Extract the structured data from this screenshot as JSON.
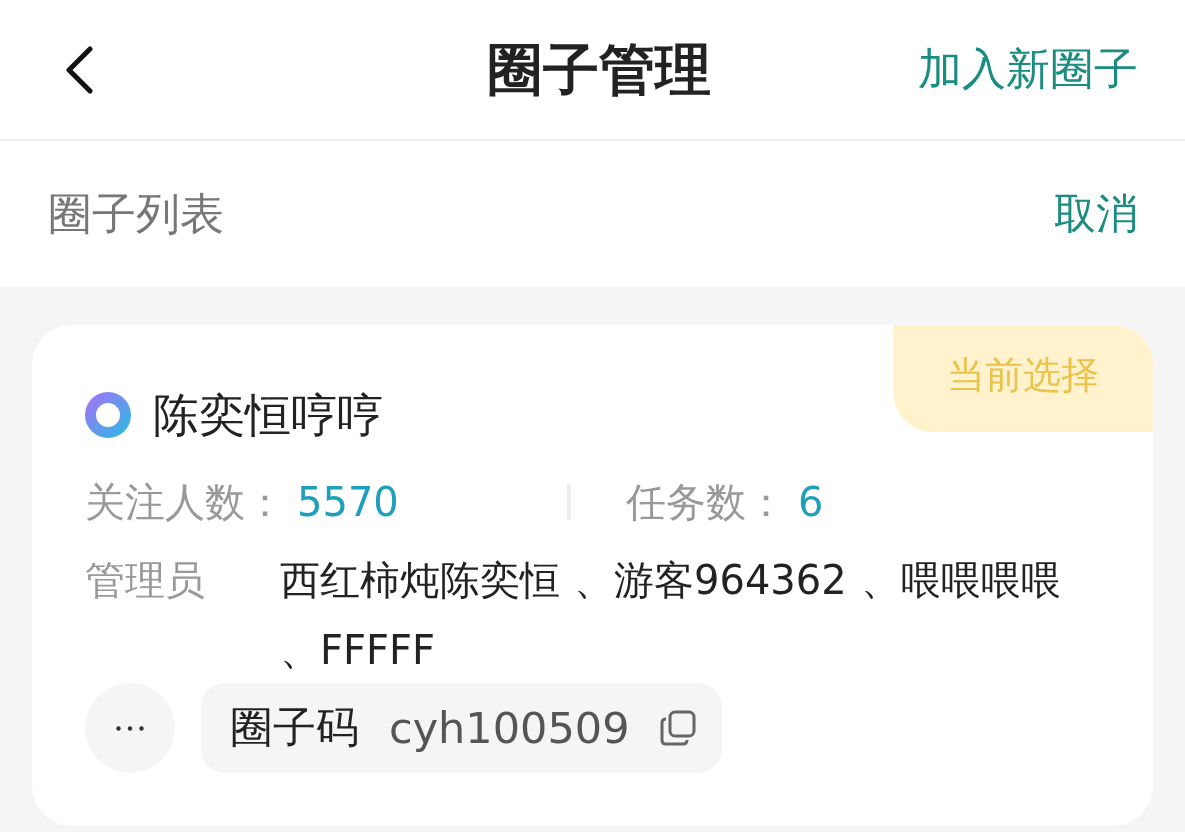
{
  "header": {
    "title": "圈子管理",
    "action": "加入新圈子"
  },
  "section": {
    "title": "圈子列表",
    "action": "取消"
  },
  "circles": [
    {
      "name": "陈奕恒哼哼",
      "selected": true,
      "badge": "当前选择",
      "stats": [
        {
          "label": "关注人数：",
          "value": "5570"
        },
        {
          "label": "任务数：",
          "value": "6"
        }
      ],
      "admins_label": "管理员",
      "admins": [
        "西红柿炖陈奕恒",
        "、游客964362",
        "、喂喂喂喂",
        "、FFFFF"
      ],
      "code_label": "圈子码",
      "code": "cyh100509"
    }
  ]
}
